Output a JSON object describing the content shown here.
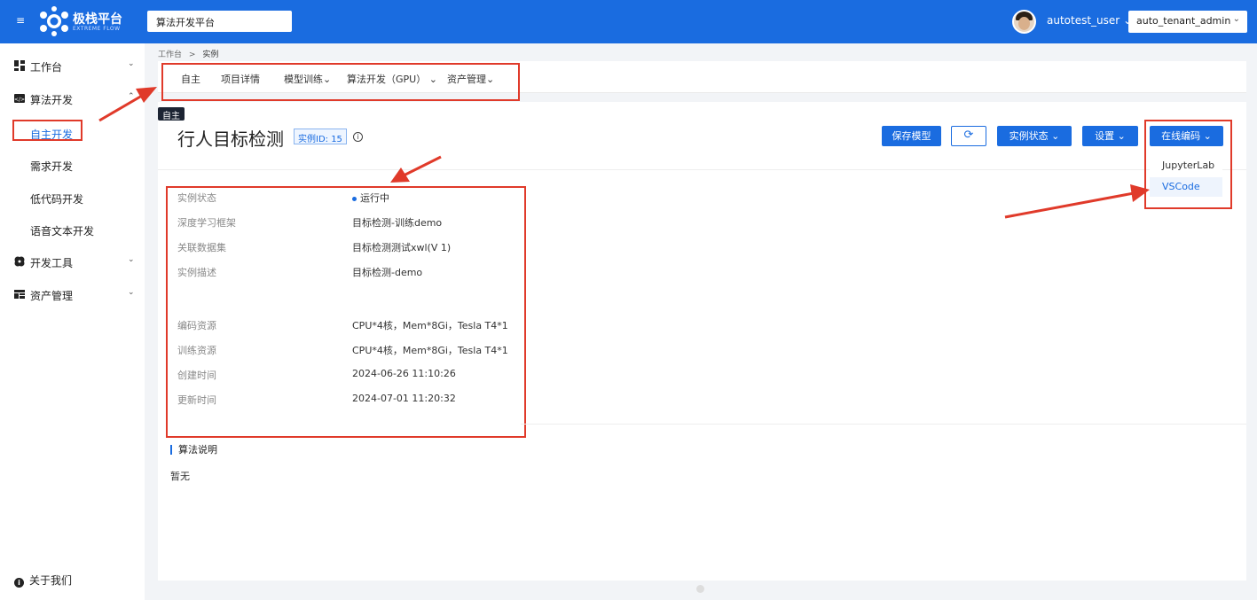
{
  "header": {
    "menu_icon": "menu-icon",
    "logo_title": "极栈平台",
    "logo_subtitle": "EXTREME FLOW",
    "platform": "算法开发平台",
    "username": "autotest_user",
    "tenant": "auto_tenant_admin"
  },
  "sidebar": {
    "items": [
      {
        "label": "工作台",
        "icon": "dashboard-icon"
      },
      {
        "label": "算法开发",
        "icon": "code-icon"
      },
      {
        "label": "开发工具",
        "icon": "tools-icon"
      },
      {
        "label": "资产管理",
        "icon": "assets-icon"
      }
    ],
    "sub_items": [
      "自主开发",
      "需求开发",
      "低代码开发",
      "语音文本开发"
    ],
    "about": "关于我们"
  },
  "breadcrumb": {
    "root": "工作台",
    "sep": ">",
    "current": "实例"
  },
  "tabs": [
    "自主",
    "项目详情",
    "模型训练",
    "算法开发（GPU）",
    "资产管理"
  ],
  "instance": {
    "tag": "自主",
    "title": "行人目标检测",
    "id_badge": "实例ID: 15"
  },
  "actions": {
    "save_model": "保存模型",
    "instance_status": "实例状态",
    "settings": "设置",
    "online_coding": "在线编码"
  },
  "dropdown": [
    "JupyterLab",
    "VSCode"
  ],
  "details": [
    {
      "label": "实例状态",
      "value": "运行中"
    },
    {
      "label": "深度学习框架",
      "value": "目标检测-训练demo"
    },
    {
      "label": "关联数据集",
      "value": "目标检测测试xwl(V 1)"
    },
    {
      "label": "实例描述",
      "value": "目标检测-demo"
    },
    {
      "label": "编码资源",
      "value": "CPU*4核，Mem*8Gi，Tesla T4*1"
    },
    {
      "label": "训练资源",
      "value": "CPU*4核，Mem*8Gi，Tesla T4*1"
    },
    {
      "label": "创建时间",
      "value": "2024-06-26 11:10:26"
    },
    {
      "label": "更新时间",
      "value": "2024-07-01 11:20:32"
    }
  ],
  "algorithm_section": {
    "title": "算法说明",
    "body": "暂无"
  },
  "colors": {
    "primary": "#1a6ce0",
    "highlight": "#e03a2a"
  }
}
